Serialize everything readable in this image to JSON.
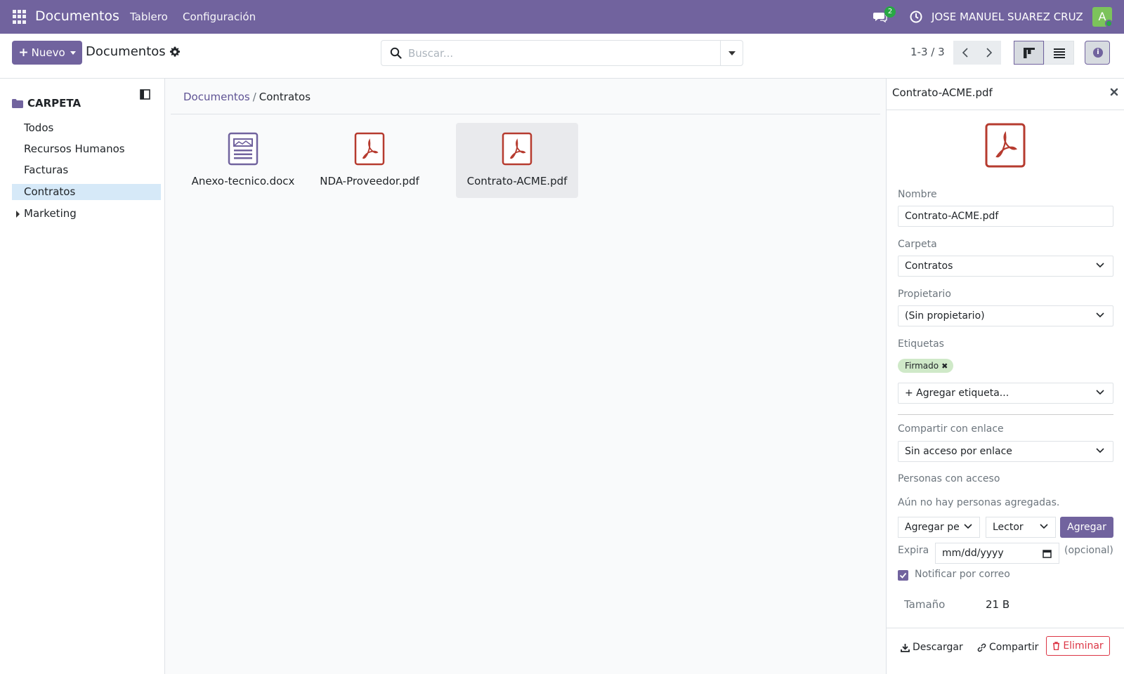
{
  "navbar": {
    "brand": "Documentos",
    "links": [
      "Tablero",
      "Configuración"
    ],
    "chat_badge": "2",
    "user_name": "JOSE MANUEL SUAREZ CRUZ",
    "avatar_letter": "A",
    "accent_color": "#71639e"
  },
  "control_panel": {
    "new_button": "Nuevo",
    "title": "Documentos",
    "search_placeholder": "Buscar...",
    "pager": "1-3 / 3"
  },
  "sidebar": {
    "header": "CARPETA",
    "items": [
      {
        "label": "Todos"
      },
      {
        "label": "Recursos Humanos"
      },
      {
        "label": "Facturas"
      },
      {
        "label": "Contratos",
        "active": true
      },
      {
        "label": "Marketing",
        "expandable": true
      }
    ]
  },
  "main": {
    "breadcrumb": {
      "parent": "Documentos",
      "separator": "/",
      "current": "Contratos"
    },
    "documents": [
      {
        "name": "Anexo-tecnico.docx",
        "icon": "image-document-icon"
      },
      {
        "name": "NDA-Proveedor.pdf",
        "icon": "pdf-icon"
      },
      {
        "name": "Contrato-ACME.pdf",
        "icon": "pdf-icon",
        "selected": true
      }
    ]
  },
  "inspector": {
    "title": "Contrato-ACME.pdf",
    "name_label": "Nombre",
    "name_value": "Contrato-ACME.pdf",
    "folder_label": "Carpeta",
    "folder_value": "Contratos",
    "owner_label": "Propietario",
    "owner_value": "(Sin propietario)",
    "tags_label": "Etiquetas",
    "tag": "Firmado",
    "tag_color": "#cfe9c8",
    "add_tag": "+ Agregar etiqueta...",
    "share_label": "Compartir con enlace",
    "share_value": "Sin acceso por enlace",
    "people_label": "Personas con acceso",
    "people_empty": "Aún no hay personas agregadas.",
    "add_person": "Agregar pe",
    "role": "Lector",
    "add_button": "Agregar",
    "expire_label": "Expira",
    "expire_placeholder": "mm/dd/yyyy",
    "optional": "(opcional)",
    "notify_label": "Notificar por correo",
    "size_label": "Tamaño",
    "size_value": "21 B",
    "download": "Descargar",
    "share": "Compartir",
    "delete": "Eliminar"
  }
}
